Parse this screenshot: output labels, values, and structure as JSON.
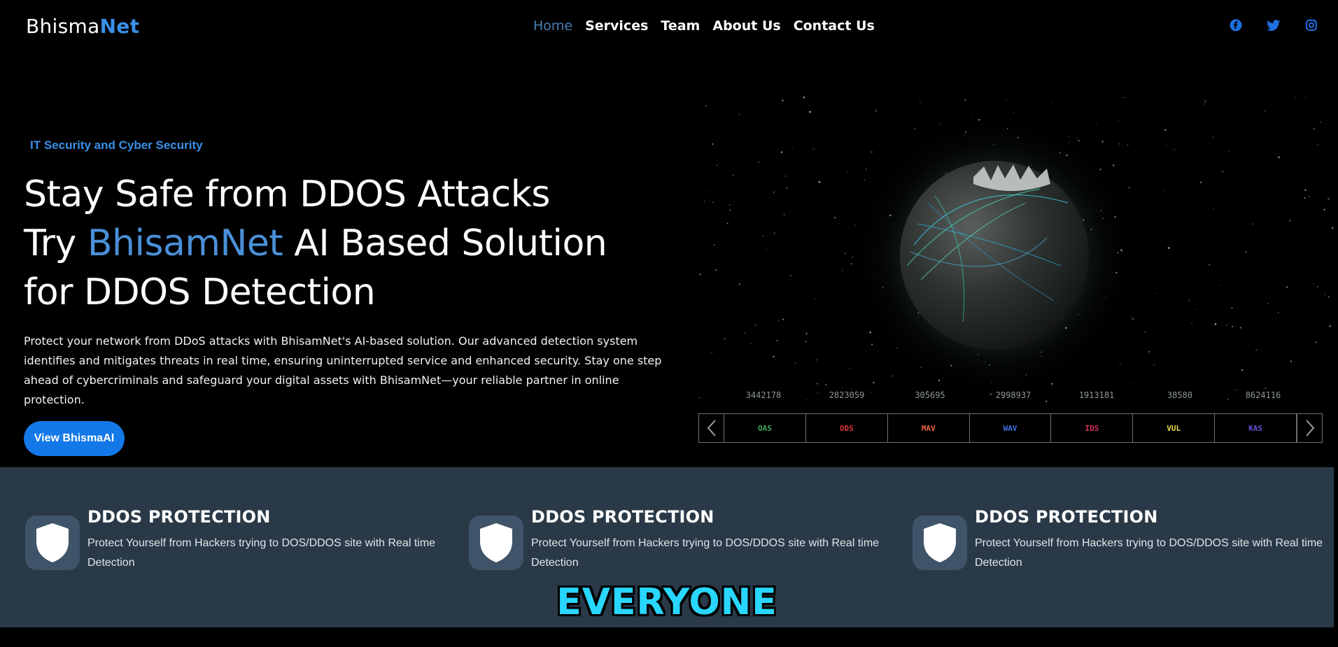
{
  "brand": {
    "name_part1": "Bhisma",
    "name_part2": "Net"
  },
  "nav": {
    "items": [
      {
        "label": "Home",
        "active": true
      },
      {
        "label": "Services",
        "active": false
      },
      {
        "label": "Team",
        "active": false
      },
      {
        "label": "About Us",
        "active": false
      },
      {
        "label": "Contact Us",
        "active": false
      }
    ]
  },
  "social": {
    "icons": [
      "facebook-icon",
      "twitter-icon",
      "instagram-icon"
    ],
    "color": "#1e6fe0"
  },
  "hero": {
    "eyebrow": "IT Security and Cyber Security",
    "line1": "Stay Safe from DDOS Attacks",
    "line2_prefix": "Try ",
    "line2_brand": "BhisamNet",
    "line2_suffix": " AI Based Solution",
    "line3": "for DDOS Detection",
    "lead": "Protect your network from DDoS attacks with BhisamNet's AI-based solution. Our advanced detection system identifies and mitigates threats in real time, ensuring uninterrupted service and enhanced security. Stay one step ahead of cybercriminals and safeguard your digital assets with BhisamNet—your reliable partner in online protection.",
    "cta_label": "View BhismaAI"
  },
  "threat_map": {
    "stats": [
      "3442178",
      "2823059",
      "305695",
      "2998937",
      "1913181",
      "38580",
      "8624116"
    ],
    "ticker": [
      {
        "label": "OAS",
        "color": "#3fa85b"
      },
      {
        "label": "ODS",
        "color": "#d9303a"
      },
      {
        "label": "MAV",
        "color": "#e5603a"
      },
      {
        "label": "WAV",
        "color": "#3a6fd9"
      },
      {
        "label": "IDS",
        "color": "#d9305a"
      },
      {
        "label": "VUL",
        "color": "#e8d640"
      },
      {
        "label": "KAS",
        "color": "#6a4fd9"
      }
    ]
  },
  "features": [
    {
      "title": "DDOS PROTECTION",
      "desc": "Protect Yourself from Hackers trying to DOS/DDOS site with Real time Detection"
    },
    {
      "title": "DDOS PROTECTION",
      "desc": "Protect Yourself from Hackers trying to DOS/DDOS site with Real time Detection"
    },
    {
      "title": "DDOS PROTECTION",
      "desc": "Protect Yourself from Hackers trying to DOS/DDOS site with Real time Detection"
    }
  ],
  "caption": "EVERYONE"
}
